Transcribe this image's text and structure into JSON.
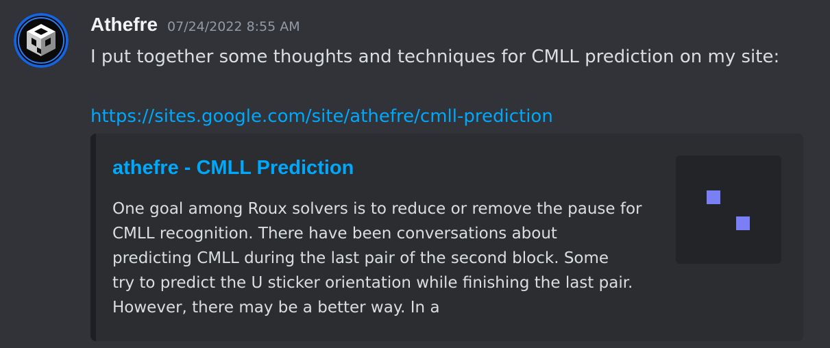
{
  "message": {
    "username": "Athefre",
    "timestamp": "07/24/2022 8:55 AM",
    "content": "I put together some thoughts and techniques for CMLL prediction on my site:",
    "link": "https://sites.google.com/site/athefre/cmll-prediction"
  },
  "embed": {
    "title": "athefre - CMLL Prediction",
    "description_lines": [
      "One goal among Roux solvers is to reduce or remove the pause for",
      "CMLL recognition. There have been conversations about",
      "predicting CMLL during the last pair of the second block. Some",
      "try to predict the U sticker orientation while finishing the last pair.",
      "However, there may be a better way. In a"
    ],
    "thumbnail_icon": "image-placeholder-icon"
  },
  "colors": {
    "background": "#313338",
    "embed_background": "#2b2d31",
    "link": "#00a8fc",
    "text": "#dbdee1",
    "muted": "#949ba4",
    "accent_square": "#7b7ff5"
  }
}
